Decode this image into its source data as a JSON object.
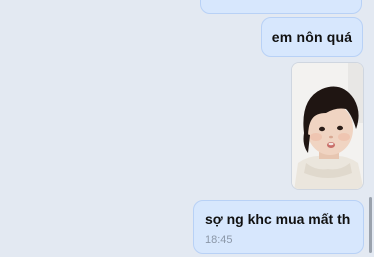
{
  "messages": [
    {
      "type": "text",
      "text": "",
      "partial": true
    },
    {
      "type": "text",
      "text": "em nôn quá"
    },
    {
      "type": "image",
      "icon": "photo-child-face"
    },
    {
      "type": "text",
      "text": "sợ ng khc mua mất th",
      "time": "18:45"
    }
  ],
  "colors": {
    "background": "#e3e9f2",
    "bubble": "#d7e7fd",
    "bubble_border": "#b8d1f6",
    "timestamp": "#8b97a8"
  }
}
